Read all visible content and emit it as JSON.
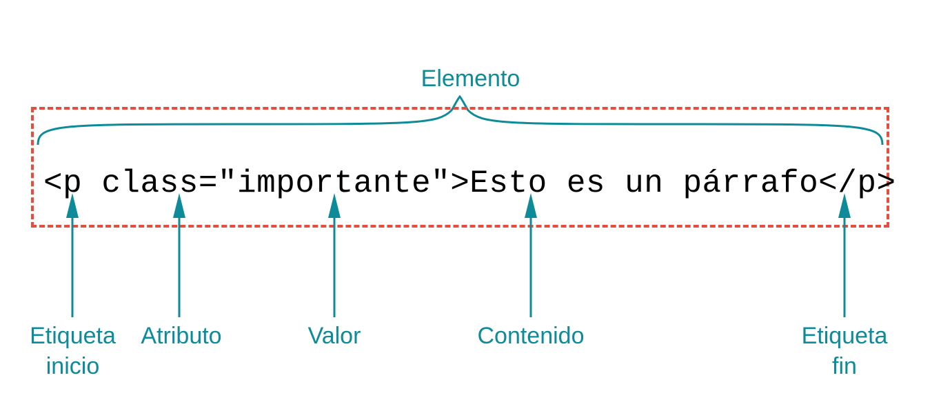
{
  "labels": {
    "top": "Elemento",
    "bottom": {
      "start_tag": "Etiqueta\ninicio",
      "attribute": "Atributo",
      "value": "Valor",
      "content": "Contenido",
      "end_tag": "Etiqueta\nfin"
    }
  },
  "code": {
    "full": "<p class=\"importante\">Esto es un párrafo</p>",
    "start_tag": "<p",
    "attribute_name": "class",
    "attribute_value": "\"importante\"",
    "text_content": "Esto es un párrafo",
    "end_tag": "</p>"
  },
  "colors": {
    "teal": "#0d8b99",
    "red_dash": "#e74c3c"
  }
}
